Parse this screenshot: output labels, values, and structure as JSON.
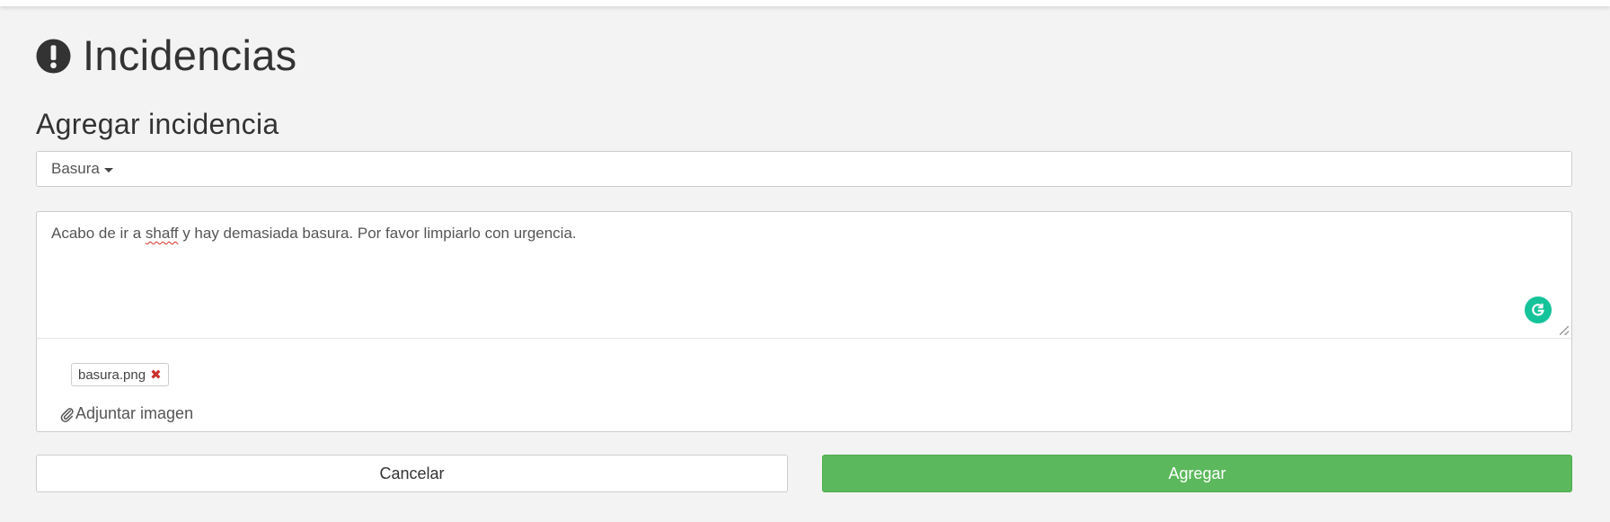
{
  "header": {
    "icon": "exclamation-circle-icon",
    "title": "Incidencias"
  },
  "form": {
    "section_title": "Agregar incidencia",
    "category": {
      "selected": "Basura"
    },
    "description": {
      "before": "Acabo de ir a ",
      "misspelled": "shaff",
      "after": " y hay demasiada basura. Por favor limpiarlo con urgencia."
    },
    "attachments": [
      {
        "filename": "basura.png",
        "remove_icon": "times-icon"
      }
    ],
    "attach_label": "Adjuntar imagen",
    "cancel_label": "Cancelar",
    "submit_label": "Agregar"
  },
  "colors": {
    "background": "#f3f3f3",
    "primary_button": "#5cb85c",
    "grammarly": "#15c39a",
    "remove": "#c9302c"
  }
}
